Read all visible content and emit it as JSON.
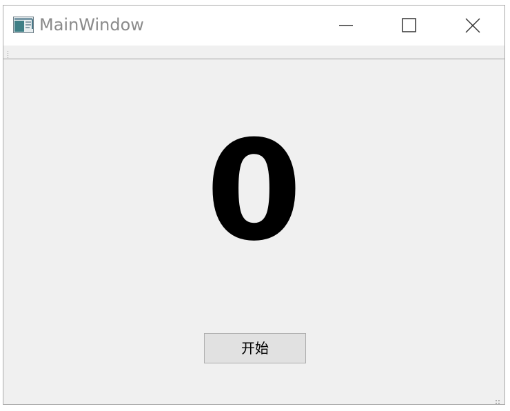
{
  "window": {
    "title": "MainWindow",
    "controls": {
      "minimize": "minimize-icon",
      "maximize": "maximize-icon",
      "close": "close-icon"
    }
  },
  "main": {
    "counter_value": "0",
    "start_button_label": "开始"
  },
  "colors": {
    "window_bg": "#f0f0f0",
    "titlebar_bg": "#ffffff",
    "title_text": "#8a8a8a",
    "button_bg": "#e1e1e1",
    "button_border": "#adadad"
  }
}
